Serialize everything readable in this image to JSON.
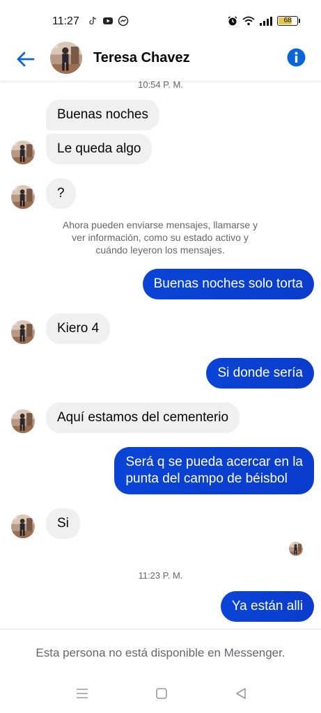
{
  "status_bar": {
    "time": "11:27",
    "battery_level": "68",
    "battery_fraction": 0.68,
    "left_icons": [
      "tiktok-icon",
      "youtube-icon",
      "messenger-icon"
    ],
    "right_icons": [
      "alarm-icon",
      "wifi-icon",
      "signal-icon",
      "battery-icon"
    ]
  },
  "header": {
    "contact_name": "Teresa Chavez",
    "back_icon": "arrow-left-icon",
    "info_icon": "info-icon"
  },
  "colors": {
    "accent": "#0a66d6",
    "outgoing_bubble": "#0a44d6",
    "incoming_bubble": "#f0f0f0",
    "meta_text": "#65676b"
  },
  "chat": {
    "timestamp_1": "10:54 P. M.",
    "messages": [
      {
        "direction": "in",
        "text": "Buenas noches"
      },
      {
        "direction": "in",
        "text": "Le queda algo"
      },
      {
        "direction": "in",
        "text": "?"
      },
      {
        "direction": "out",
        "text": "Buenas noches solo torta"
      },
      {
        "direction": "in",
        "text": "Kiero 4"
      },
      {
        "direction": "out",
        "text": "Si donde sería"
      },
      {
        "direction": "in",
        "text": "Aquí estamos del cementerio"
      },
      {
        "direction": "out",
        "lines": [
          "Será q se pueda acercar en la",
          "punta del campo de béisbol"
        ]
      },
      {
        "direction": "in",
        "text": "Si"
      },
      {
        "direction": "out",
        "text": "Ya están alli"
      }
    ],
    "notice_lines": [
      "Ahora pueden enviarse mensajes, llamarse y",
      "ver información, como su estado activo y",
      "cuándo leyeron los mensajes."
    ],
    "timestamp_2": "11:23 P. M."
  },
  "footer": {
    "unavailable_text": "Esta persona no está disponible en Messenger."
  },
  "nav_bar": {
    "buttons": [
      "menu-icon",
      "home-icon",
      "back-triangle-icon"
    ]
  }
}
